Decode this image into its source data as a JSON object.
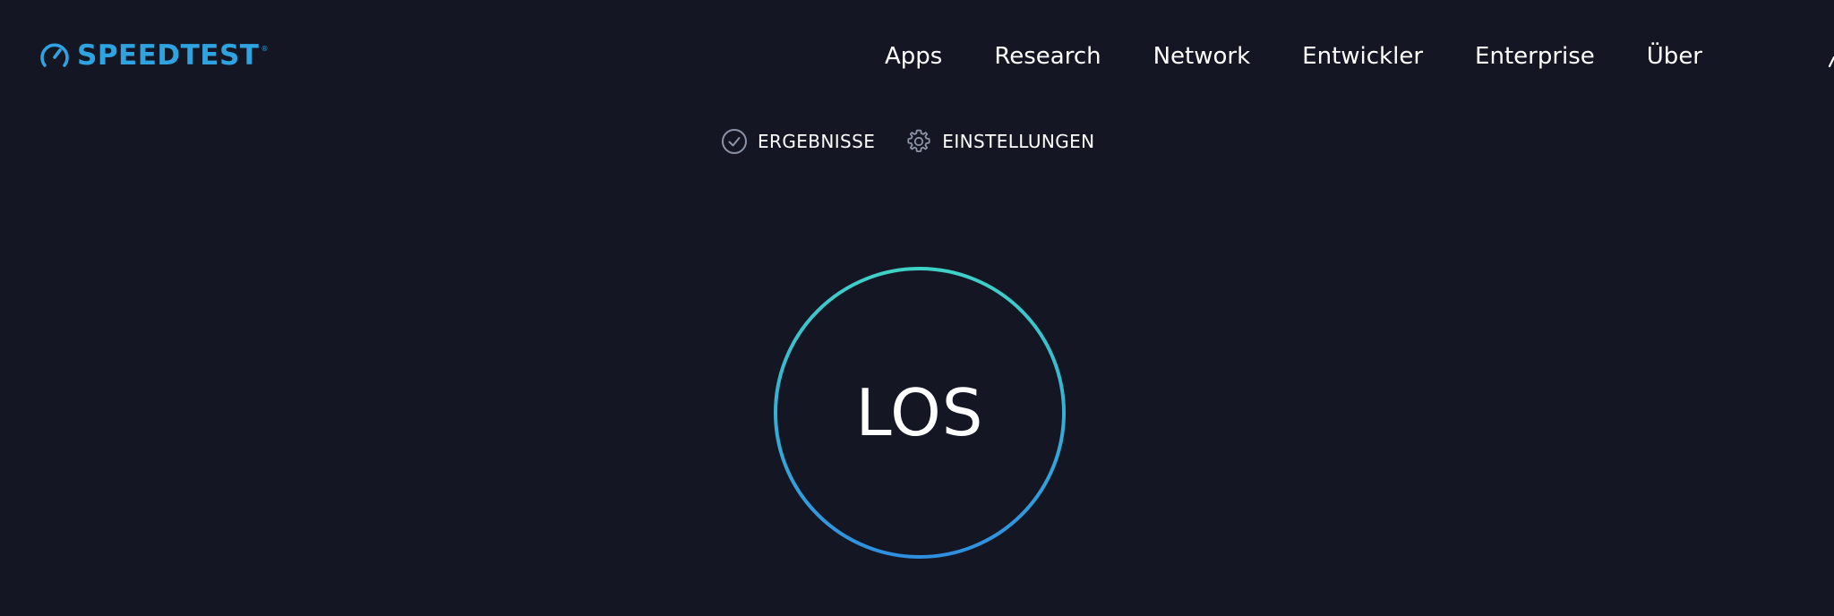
{
  "header": {
    "logo_text": "SPEEDTEST",
    "logo_mark": "®",
    "logo_icon": "speedometer-icon",
    "nav": [
      {
        "label": "Apps"
      },
      {
        "label": "Research"
      },
      {
        "label": "Network"
      },
      {
        "label": "Entwickler"
      },
      {
        "label": "Enterprise"
      },
      {
        "label": "Über"
      }
    ]
  },
  "subnav": {
    "results_label": "ERGEBNISSE",
    "results_icon": "check-circle-icon",
    "settings_label": "EINSTELLUNGEN",
    "settings_icon": "gear-icon"
  },
  "main": {
    "go_label": "LOS"
  },
  "colors": {
    "background": "#141624",
    "brand_blue": "#2ea3e0",
    "ring_teal": "#3fd1c6",
    "ring_blue": "#2f8fe0",
    "text": "#ffffff",
    "icon_gray": "#8d93a6"
  }
}
